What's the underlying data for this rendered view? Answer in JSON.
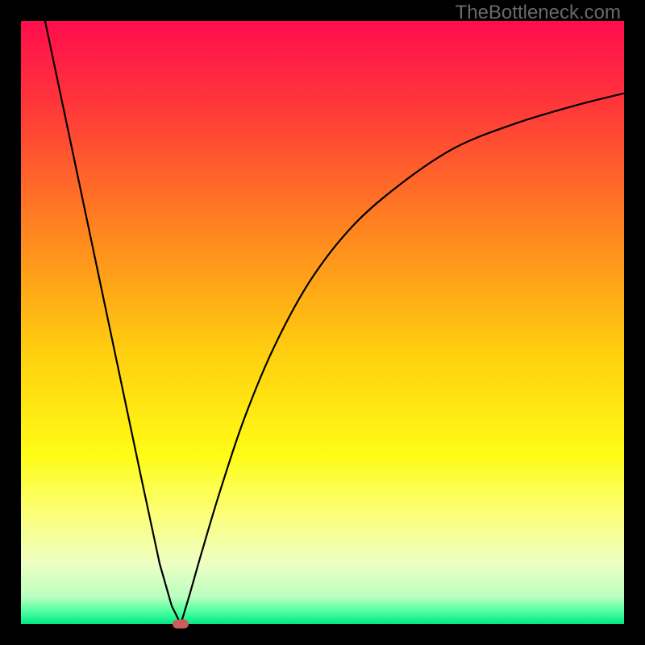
{
  "watermark": "TheBottleneck.com",
  "chart_data": {
    "type": "line",
    "title": "",
    "xlabel": "",
    "ylabel": "",
    "xlim": [
      0,
      100
    ],
    "ylim": [
      0,
      100
    ],
    "gradient_stops": [
      {
        "offset": 0.0,
        "color": "#ff0d4d"
      },
      {
        "offset": 0.14,
        "color": "#ff373a"
      },
      {
        "offset": 0.34,
        "color": "#ff8220"
      },
      {
        "offset": 0.55,
        "color": "#ffcf0f"
      },
      {
        "offset": 0.72,
        "color": "#fffc16"
      },
      {
        "offset": 0.82,
        "color": "#fbff7b"
      },
      {
        "offset": 0.9,
        "color": "#eeffc4"
      },
      {
        "offset": 0.955,
        "color": "#baffbf"
      },
      {
        "offset": 0.98,
        "color": "#4cff9f"
      },
      {
        "offset": 1.0,
        "color": "#00e884"
      }
    ],
    "series": [
      {
        "name": "left-branch",
        "x": [
          4,
          8,
          12,
          16,
          20,
          23,
          25,
          26.5
        ],
        "y": [
          100,
          81,
          62,
          43,
          24,
          10,
          3,
          0
        ]
      },
      {
        "name": "right-branch",
        "x": [
          26.5,
          28,
          30,
          33,
          37,
          42,
          48,
          55,
          63,
          72,
          82,
          92,
          100
        ],
        "y": [
          0,
          5,
          12,
          22,
          34,
          46,
          57,
          66,
          73,
          79,
          83,
          86,
          88
        ]
      }
    ],
    "minimum_marker": {
      "x": 26.5,
      "y": 0,
      "color": "#cd5c5c"
    }
  }
}
